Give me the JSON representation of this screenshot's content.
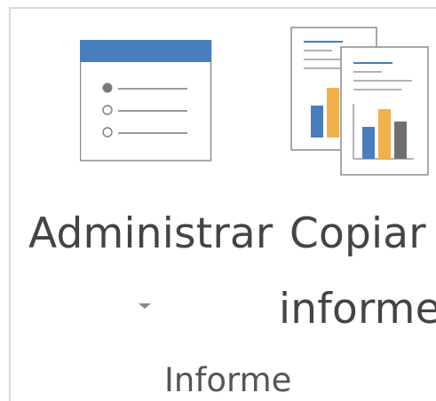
{
  "ribbon": {
    "buttons": {
      "manage": {
        "label": "Administrar",
        "icon": "list-window-icon",
        "has_dropdown": true
      },
      "copy": {
        "label_line1": "Copiar",
        "label_line2": "informe",
        "icon": "copy-report-icon"
      }
    },
    "group_label": "Informe"
  },
  "colors": {
    "accent_blue": "#4a7dbc",
    "bar_orange": "#f0b14a",
    "bar_gray": "#6f6f6f",
    "border": "#d8d8d8",
    "text": "#444444"
  }
}
